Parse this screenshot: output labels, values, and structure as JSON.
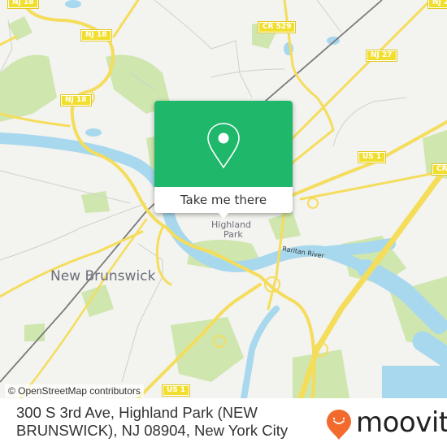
{
  "map": {
    "attribution": "© OpenStreetMap contributors",
    "colors": {
      "land": "#f3f3ef",
      "water": "#a8d8ee",
      "park": "#cfe6ae",
      "road_major": "#f5dd5c",
      "road_minor": "#c8c8c8",
      "rail": "#777777",
      "popup_green": "#1fb86a",
      "shield_fill": "#f2de2c"
    },
    "road_shields": [
      {
        "label": "NJ 18",
        "id": "nj-18-top-left"
      },
      {
        "label": "NJ 18",
        "id": "nj-18-upper"
      },
      {
        "label": "NJ 18",
        "id": "nj-18-mid"
      },
      {
        "label": "CR 529",
        "id": "cr-529"
      },
      {
        "label": "NJ 27",
        "id": "nj-27"
      },
      {
        "label": "US 1",
        "id": "us-1-right"
      },
      {
        "label": "CR",
        "id": "cr-right-edge"
      },
      {
        "label": "NJ 2",
        "id": "nj-top-right-edge"
      },
      {
        "label": "US 1",
        "id": "us-1-bottom"
      }
    ],
    "places": {
      "city": "New Brunswick",
      "town_line1": "Highland",
      "town_line2": "Park",
      "river": "Raritan River"
    }
  },
  "popup": {
    "icon": "map-pin-icon",
    "button_label": "Take me there"
  },
  "footer": {
    "address": "300 S 3rd Ave, Highland Park (NEW BRUNSWICK), NJ 08904, New York City",
    "brand": "moovit",
    "brand_color": "#f26a2e"
  }
}
